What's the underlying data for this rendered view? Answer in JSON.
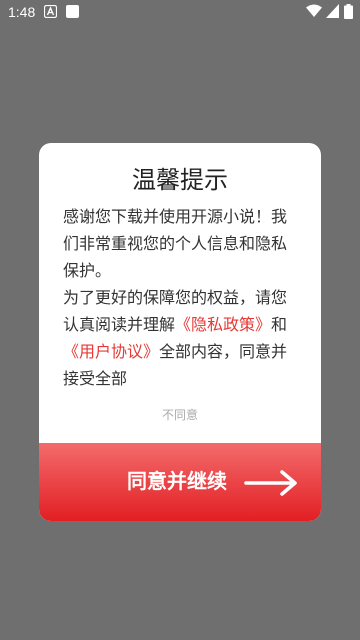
{
  "status_bar": {
    "time": "1:48"
  },
  "dialog": {
    "title": "温馨提示",
    "body_text_1": "感谢您下载并使用开源小说！我们非常重视您的个人信息和隐私保护。",
    "body_text_2": "为了更好的保障您的权益，请您认真阅读并理解",
    "privacy_link": "《隐私政策》",
    "and_text": "和",
    "agreement_link": "《用户协议》",
    "body_text_3": "全部内容，同意并接受全部",
    "disagree_label": "不同意",
    "agree_label": "同意并继续"
  },
  "colors": {
    "overlay": "#6f6f6f",
    "accent": "#e53935"
  }
}
